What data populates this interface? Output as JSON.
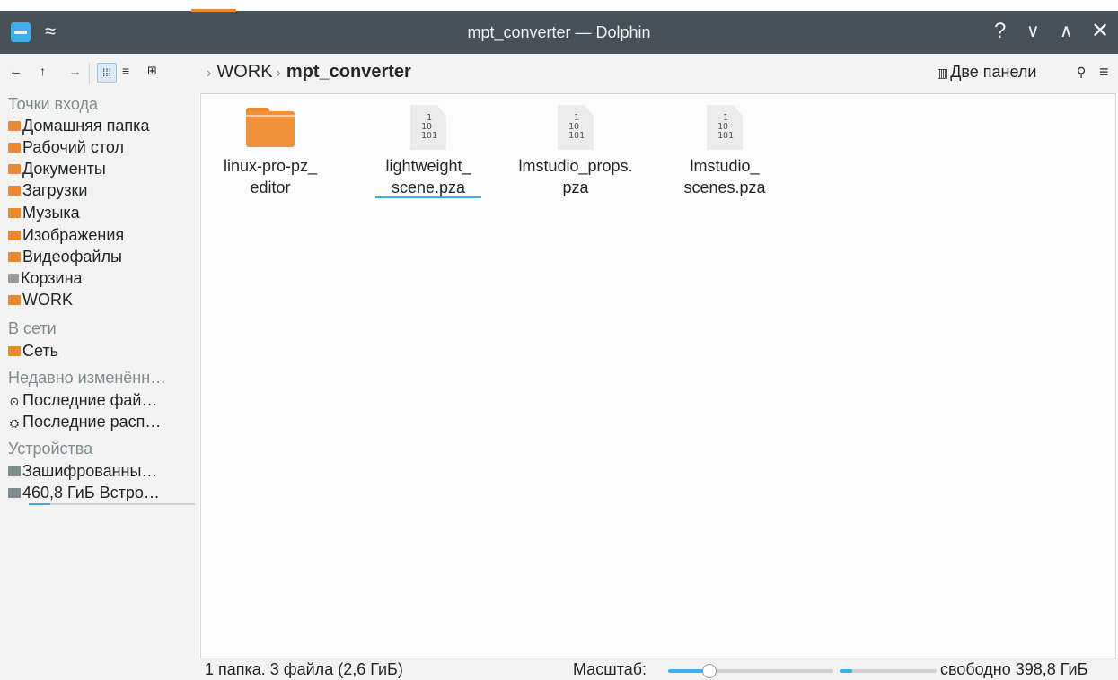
{
  "window": {
    "title": "mpt_converter — Dolphin",
    "keep_above_glyph": "≈",
    "help_glyph": "?",
    "minimize_glyph": "∨",
    "maximize_glyph": "∧",
    "close_glyph": "✕"
  },
  "toolbar": {
    "back_glyph": "←",
    "up_glyph": "↑",
    "forward_glyph": "→",
    "view_icons_glyph": "⁞⁞⁞",
    "view_details_glyph": "≡",
    "view_tree_glyph": "⊞",
    "breadcrumb": [
      "WORK",
      "mpt_converter"
    ],
    "split_label": "Две панели",
    "split_glyph": "▥",
    "search_glyph": "⚲",
    "menu_glyph": "≡"
  },
  "sidebar": {
    "places_heading": "Точки входа",
    "places": [
      {
        "label": "Домашняя папка",
        "icon": "home-folder-icon"
      },
      {
        "label": "Рабочий стол",
        "icon": "desktop-icon"
      },
      {
        "label": "Документы",
        "icon": "documents-folder-icon"
      },
      {
        "label": "Загрузки",
        "icon": "downloads-folder-icon"
      },
      {
        "label": "Музыка",
        "icon": "music-folder-icon"
      },
      {
        "label": "Изображения",
        "icon": "pictures-folder-icon"
      },
      {
        "label": "Видеофайлы",
        "icon": "videos-folder-icon"
      },
      {
        "label": "Корзина",
        "icon": "trash-icon"
      },
      {
        "label": "WORK",
        "icon": "folder-icon"
      }
    ],
    "network_heading": "В сети",
    "network": [
      {
        "label": "Сеть",
        "icon": "network-folder-icon"
      }
    ],
    "recent_heading": "Недавно изменённ…",
    "recent": [
      {
        "label": "Последние фай…",
        "icon": "clock-icon",
        "glyph": "⊙"
      },
      {
        "label": "Последние расп…",
        "icon": "recent-locations-icon",
        "glyph": "⛭"
      }
    ],
    "devices_heading": "Устройства",
    "devices": [
      {
        "label": "Зашифрованны…",
        "icon": "encrypted-drive-icon"
      },
      {
        "label": "460,8 ГиБ Встро…",
        "icon": "drive-icon",
        "usage_fraction": 0.13
      }
    ]
  },
  "files": [
    {
      "name_line1": "linux-pro-pz_",
      "name_line2": "editor",
      "type": "folder",
      "icon": "folder-icon"
    },
    {
      "name_line1": "lightweight_",
      "name_line2": "scene.pza",
      "type": "binary",
      "icon": "binary-file-icon"
    },
    {
      "name_line1": "lmstudio_props.",
      "name_line2": "pza",
      "type": "binary",
      "icon": "binary-file-icon"
    },
    {
      "name_line1": "lmstudio_",
      "name_line2": "scenes.pza",
      "type": "binary",
      "icon": "binary-file-icon"
    }
  ],
  "binary_glyph": " 1\n10\n101",
  "statusbar": {
    "summary": "1 папка. 3 файла (2,6 ГиБ)",
    "zoom_label": "Масштаб:",
    "zoom_fraction": 0.25,
    "space_fraction": 0.13,
    "free_space": "свободно 398,8 ГиБ"
  },
  "colors": {
    "accent": "#3daee9",
    "folder": "#e88a2d",
    "titlebar": "#475057"
  }
}
